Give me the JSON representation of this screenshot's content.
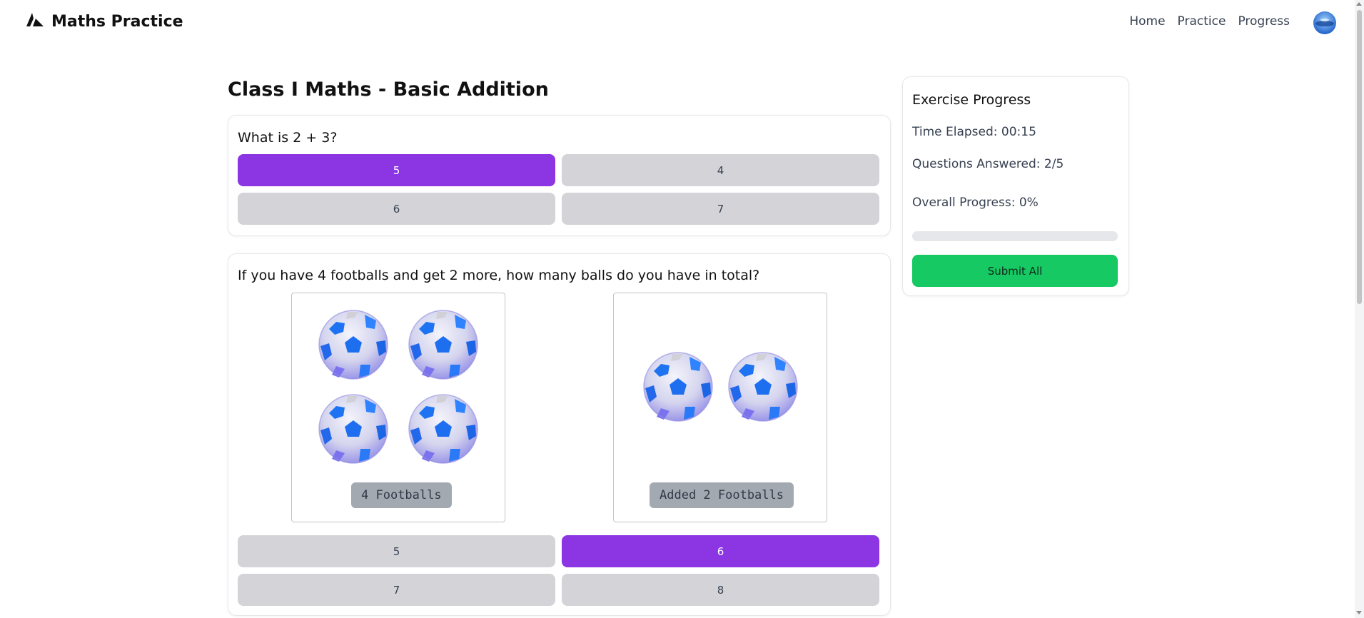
{
  "app": {
    "name": "Maths Practice"
  },
  "nav": {
    "home": "Home",
    "practice": "Practice",
    "progress": "Progress"
  },
  "page": {
    "title": "Class I Maths - Basic Addition"
  },
  "questions": [
    {
      "text": "What is 2 + 3?",
      "options": [
        "5",
        "4",
        "6",
        "7"
      ],
      "selected": "5"
    },
    {
      "text": "If you have 4 footballs and get 2 more, how many balls do you have in total?",
      "pictures": [
        {
          "label": "4 Footballs",
          "count": 4
        },
        {
          "label": "Added 2 Footballs",
          "count": 2
        }
      ],
      "options": [
        "5",
        "6",
        "7",
        "8"
      ],
      "selected": "6"
    }
  ],
  "sidebar": {
    "title": "Exercise Progress",
    "time_elapsed": "Time Elapsed: 00:15",
    "questions_answered": "Questions Answered: 2/5",
    "overall_progress": "Overall Progress: 0%",
    "progress_percent": 0,
    "submit_label": "Submit All"
  },
  "colors": {
    "accent": "#8b35e3",
    "option_default": "#d4d4d8",
    "submit": "#16c963",
    "picture_label_bg": "#a3a9b1"
  },
  "icons": {
    "logo": "triangle-logo-icon",
    "avatar": "avatar",
    "football": "football-icon"
  }
}
